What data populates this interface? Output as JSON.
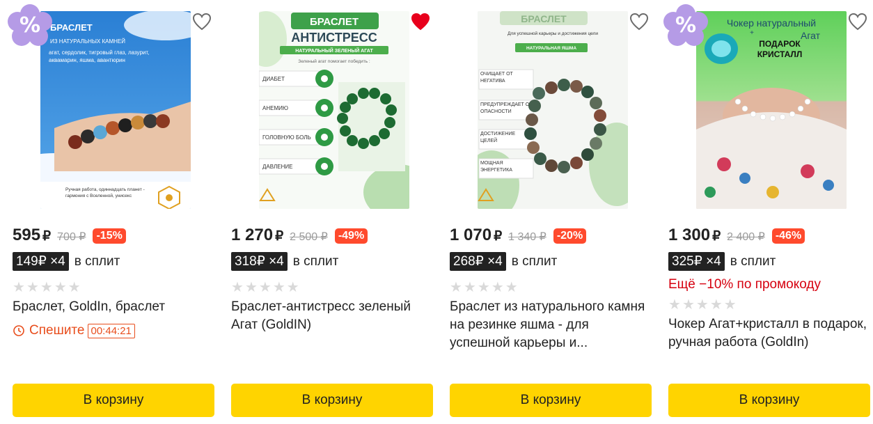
{
  "colors": {
    "cart_button": "#ffd400",
    "discount_badge": "#ff4a2d",
    "split_badge": "#222222",
    "promo_text": "#d6000f",
    "hurry": "#e84d1c",
    "fav_active": "#e8001c",
    "discount_flower": "#b59be6"
  },
  "products": [
    {
      "price": "595",
      "currency": "₽",
      "old_price": "700 ₽",
      "discount": "-15%",
      "split_badge": "149₽ ×4",
      "split_text": "в сплит",
      "rating_stars": 0,
      "title": "Браслет, GoldIn, браслет",
      "hurry_label": "Спешите",
      "timer": "00:44:21",
      "has_discount_flower": true,
      "discount_flower_symbol": "%",
      "favorited": false,
      "button_label": "В корзину",
      "image": {
        "title": "БРАСЛЕТ",
        "subtitle": "ИЗ НАТУРАЛЬНЫХ КАМНЕЙ",
        "stones": "агат, сердолик, тигровый глаз, лазурит, аквамарин, яшма, авантюрин",
        "footer": "Ручная работа, одиннадцать планет - гармония с Вселенной, унисекс"
      }
    },
    {
      "price": "1 270",
      "currency": "₽",
      "old_price": "2 500 ₽",
      "discount": "-49%",
      "split_badge": "318₽ ×4",
      "split_text": "в сплит",
      "rating_stars": 0,
      "title": "Браслет-антистресс зеленый Агат (GoldIN)",
      "has_discount_flower": false,
      "favorited": true,
      "button_label": "В корзину",
      "image": {
        "tag": "БРАСЛЕТ",
        "title": "АНТИСТРЕСС",
        "ribbon": "НАТУРАЛЬНЫЙ ЗЕЛЕНЫЙ АГАТ",
        "helps": "Зеленый агат помогает победить :",
        "items": [
          "ДИАБЕТ",
          "АНЕМИЮ",
          "ГОЛОВНУЮ БОЛЬ",
          "ДАВЛЕНИЕ"
        ]
      }
    },
    {
      "price": "1 070",
      "currency": "₽",
      "old_price": "1 340 ₽",
      "discount": "-20%",
      "split_badge": "268₽ ×4",
      "split_text": "в сплит",
      "rating_stars": 0,
      "title": "Браслет из натурального камня на резинке яшма - для успешной карьеры и...",
      "has_discount_flower": false,
      "favorited": false,
      "button_label": "В корзину",
      "image": {
        "tag": "БРАСЛЕТ",
        "subtitle": "Для успешной карьеры и достижения цели",
        "ribbon": "НАТУРАЛЬНАЯ ЯШМА",
        "items": [
          "ОЧИЩАЕТ ОТ НЕГАТИВА",
          "ПРЕДУПРЕЖДАЕТ ОБ ОПАСНОСТИ",
          "ДОСТИЖЕНИЕ ЦЕЛЕЙ",
          "МОЩНАЯ ЭНЕРГЕТИКА"
        ]
      }
    },
    {
      "price": "1 300",
      "currency": "₽",
      "old_price": "2 400 ₽",
      "discount": "-46%",
      "split_badge": "325₽ ×4",
      "split_text": "в сплит",
      "promo": "Ещё −10% по промокоду",
      "rating_stars": 0,
      "title": "Чокер Агат+кристалл в подарок, ручная работа (GoldIn)",
      "has_discount_flower": true,
      "discount_flower_symbol": "%",
      "favorited": false,
      "button_label": "В корзину",
      "image": {
        "title": "Чокер натуральный",
        "title2": "Агат",
        "plus": "+",
        "gift": "ПОДАРОК КРИСТАЛЛ"
      }
    }
  ]
}
